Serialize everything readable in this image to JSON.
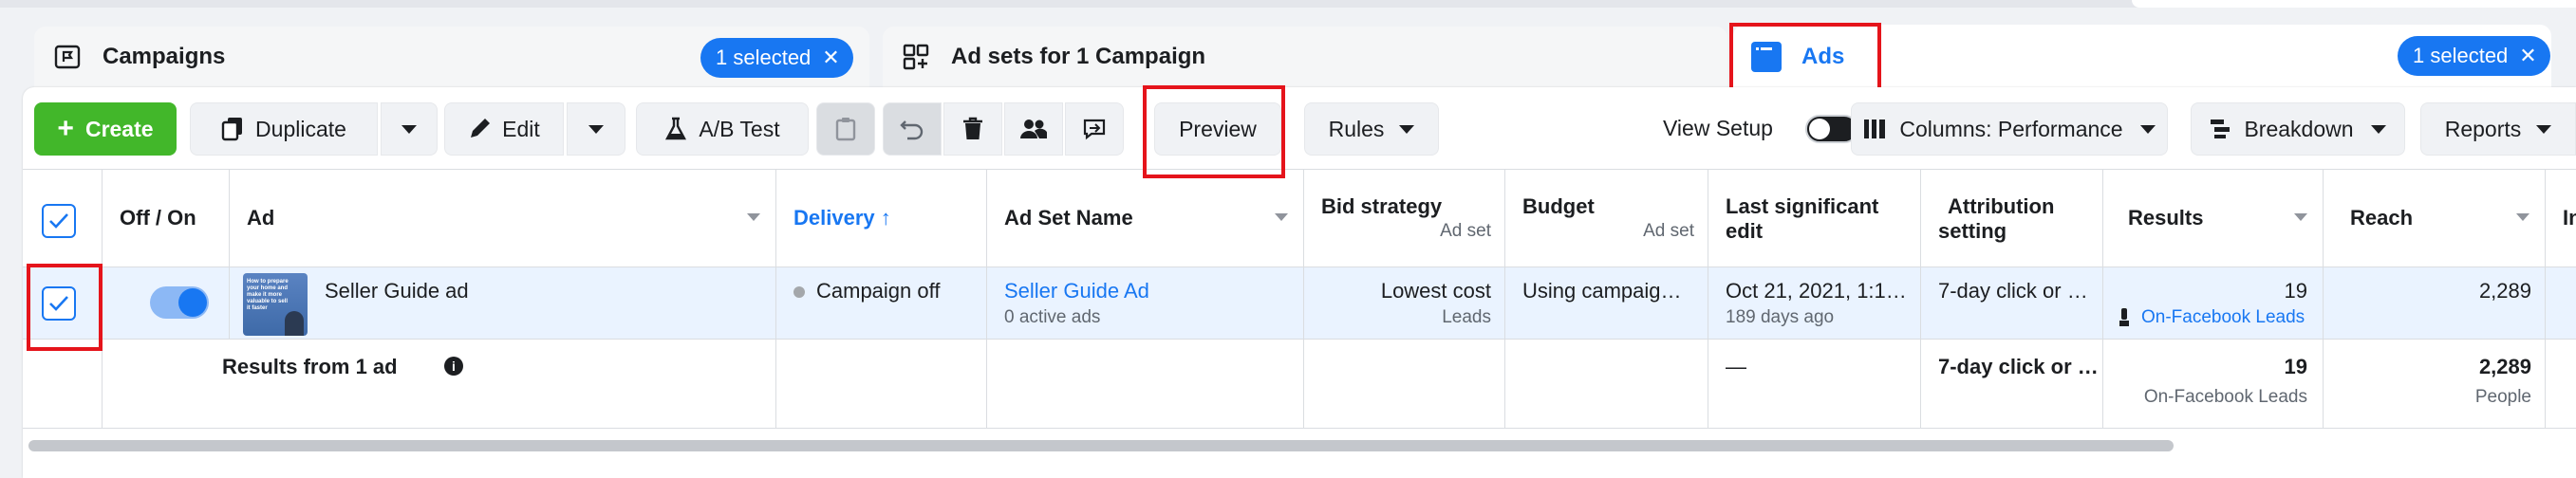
{
  "tabs": {
    "campaigns": {
      "label": "Campaigns",
      "badge": "1 selected"
    },
    "adsets": {
      "label": "Ad sets for 1 Campaign"
    },
    "ads": {
      "label": "Ads",
      "badge": "1 selected"
    }
  },
  "toolbar": {
    "create": "Create",
    "duplicate": "Duplicate",
    "edit": "Edit",
    "ab_test": "A/B Test",
    "preview": "Preview",
    "rules": "Rules",
    "view_setup": "View Setup",
    "columns": "Columns: Performance",
    "breakdown": "Breakdown",
    "reports": "Reports"
  },
  "columns": {
    "off_on": "Off / On",
    "ad": "Ad",
    "delivery": "Delivery ↑",
    "ad_set_name": "Ad Set Name",
    "bid_strategy": "Bid strategy",
    "bid_strategy_sub": "Ad set",
    "budget": "Budget",
    "budget_sub": "Ad set",
    "last_edit_1": "Last significant",
    "last_edit_2": "edit",
    "attribution_1": "Attribution",
    "attribution_2": "setting",
    "results": "Results",
    "reach": "Reach",
    "next": "In"
  },
  "row": {
    "ad_name": "Seller Guide ad",
    "thumb_text": "How to prepare your home and make it more valuable to sell it faster",
    "delivery": "Campaign off",
    "ad_set_name": "Seller Guide Ad",
    "ad_set_sub": "0 active ads",
    "bid_strategy": "Lowest cost",
    "bid_strategy_sub": "Leads",
    "budget": "Using campaig…",
    "last_edit": "Oct 21, 2021, 1:1…",
    "last_edit_sub": "189 days ago",
    "attribution": "7-day click or …",
    "results": "19",
    "results_sub": "On-Facebook Leads",
    "reach": "2,289"
  },
  "summary": {
    "label": "Results from 1 ad",
    "last_edit": "—",
    "attribution": "7-day click or …",
    "results": "19",
    "results_sub": "On-Facebook Leads",
    "reach": "2,289",
    "reach_sub": "People"
  },
  "colors": {
    "accent": "#1877f2",
    "create": "#42b72a",
    "highlight": "#e5141b"
  }
}
